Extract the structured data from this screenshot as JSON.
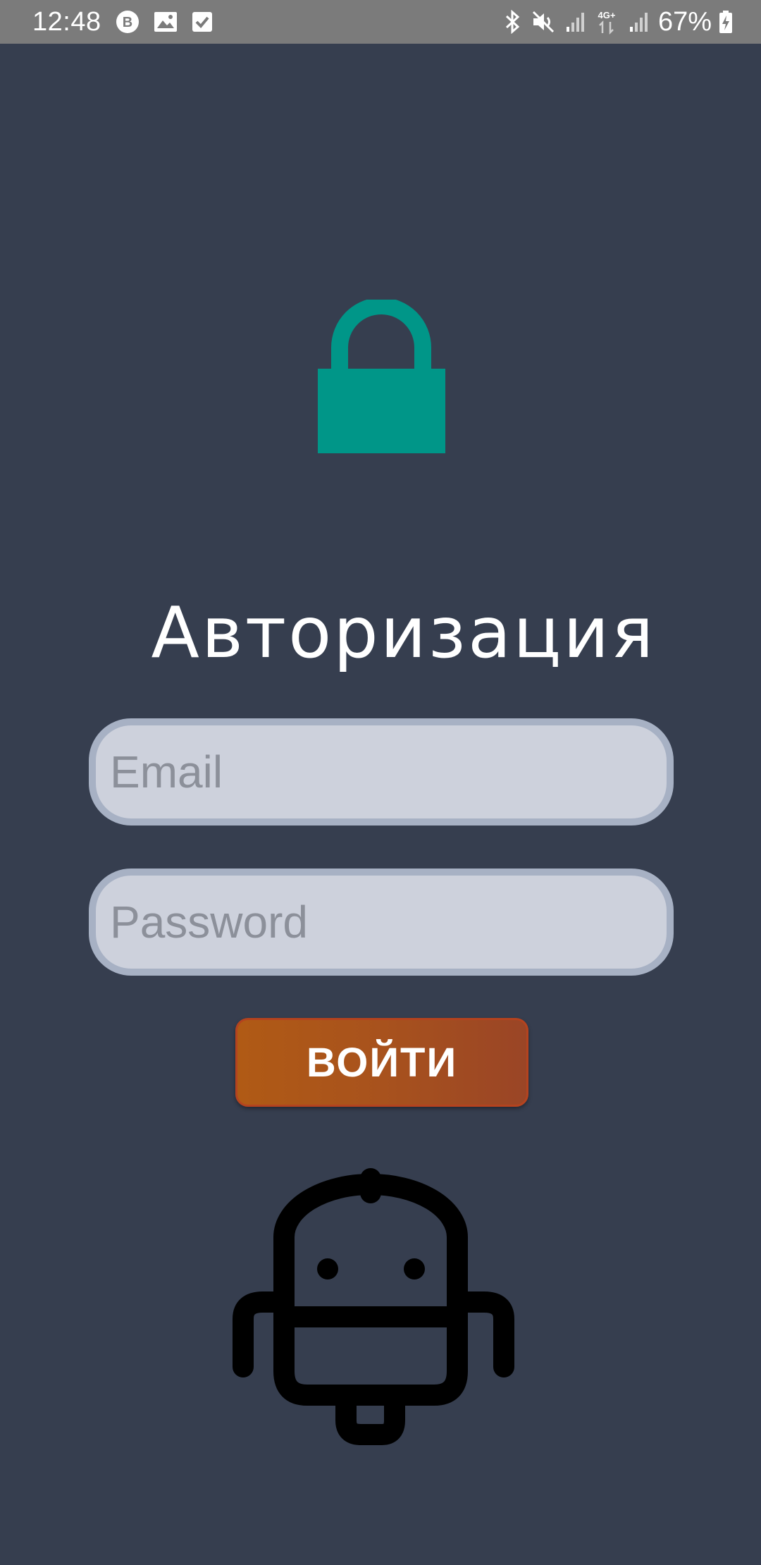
{
  "status_bar": {
    "time": "12:48",
    "notification_icons": [
      "vk-icon",
      "image-icon",
      "checkbox-icon"
    ],
    "system_icons": [
      "bluetooth-icon",
      "mute-icon",
      "signal-icon",
      "network-4g-icon",
      "signal-icon"
    ],
    "battery_percent": "67%"
  },
  "login": {
    "lock_icon": "lock-icon",
    "lock_color": "#009688",
    "title": "Авторизация",
    "email_placeholder": "Email",
    "password_placeholder": "Password",
    "login_button_label": "ВОЙТИ",
    "button_color": "#a8521d",
    "robot_icon": "android-robot-icon"
  },
  "colors": {
    "background": "#363e4f",
    "status_bar": "#7b7b7b",
    "field_background": "#cdd1dc",
    "field_border": "#a7b1c4"
  }
}
